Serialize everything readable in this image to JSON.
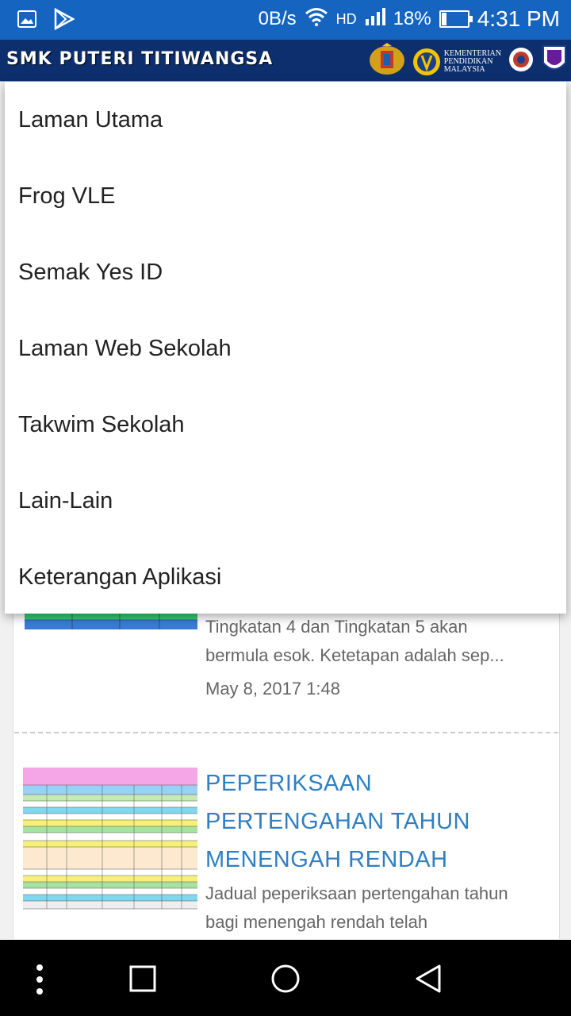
{
  "status_bar": {
    "speed": "0B/s",
    "network": "HD",
    "battery_percent": "18%",
    "battery_level": 0.18,
    "time": "4:31 PM"
  },
  "header": {
    "title": "SMK PUTERI TITIWANGSA",
    "ministry_line1": "KEMENTERIAN",
    "ministry_line2": "PENDIDIKAN",
    "ministry_line3": "MALAYSIA"
  },
  "menu": {
    "items": [
      {
        "label": "Laman Utama"
      },
      {
        "label": "Frog VLE"
      },
      {
        "label": "Semak Yes ID"
      },
      {
        "label": "Laman Web Sekolah"
      },
      {
        "label": "Takwim Sekolah"
      },
      {
        "label": "Lain-Lain"
      },
      {
        "label": "Keterangan Aplikasi"
      }
    ]
  },
  "posts": [
    {
      "excerpt_line1": "Tingkatan 4 dan Tingkatan 5 akan",
      "excerpt_line2": "bermula esok. Ketetapan adalah sep...",
      "date": "May 8, 2017 1:48"
    },
    {
      "title_line1": "PEPERIKSAAN",
      "title_line2": "PERTENGAHAN TAHUN",
      "title_line3": "MENENGAH RENDAH",
      "excerpt_line1": "Jadual peperiksaan pertengahan tahun",
      "excerpt_line2": "bagi menengah rendah telah"
    }
  ],
  "colors": {
    "status_bar": "#1565c0",
    "banner": "#0d2f6e",
    "link_title": "#2f7fc2"
  }
}
